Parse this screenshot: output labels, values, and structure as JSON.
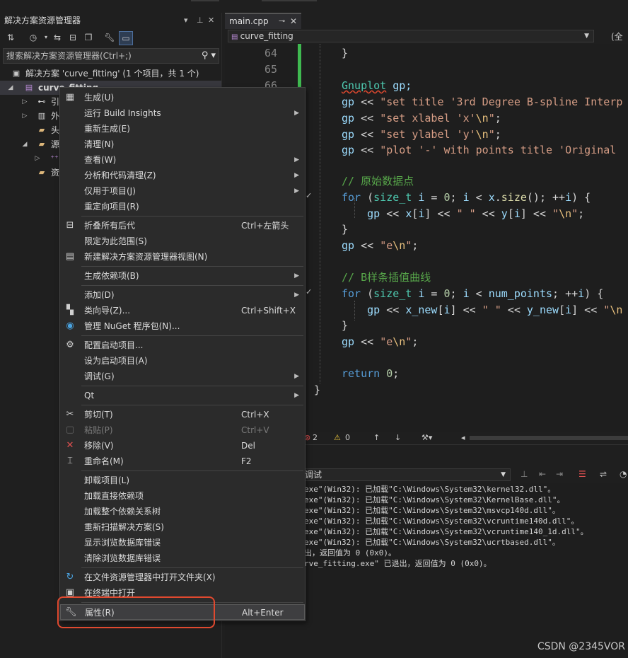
{
  "solution_explorer": {
    "title": "解决方案资源管理器",
    "controls": [
      "▾",
      "⊥",
      "✕"
    ],
    "search_placeholder": "搜索解决方案资源管理器(Ctrl+;)",
    "solution_label": "解决方案 'curve_fitting' (1 个项目，共 1 个)",
    "project_label": "curve_fitting",
    "tree_items": [
      "引",
      "外",
      "头",
      "源",
      "",
      "资"
    ]
  },
  "editor": {
    "tab_label": "main.cpp",
    "nav_scope": "curve_fitting",
    "nav_right": "(全局",
    "line_numbers": [
      "64",
      "65",
      "66"
    ],
    "lines": {
      "l64": "}",
      "l66_type": "Gnuplot",
      "l66_var": " gp;",
      "l67": "\"set title '3rd Degree B-spline Interp",
      "l68": "\"set xlabel 'x'",
      "l69": "\"set ylabel 'y'",
      "l70": "\"plot '-' with points title 'Original ",
      "c1": "// 原始数据点",
      "c2": "// B样条插值曲线",
      "ret": "return",
      "ret_val": "0"
    },
    "status": {
      "errors": "2",
      "warnings": "0"
    }
  },
  "output": {
    "source": "调试",
    "lines": [
      "exe\"(Win32): 已加载\"C:\\Windows\\System32\\kernel32.dll\"。",
      "exe\"(Win32): 已加载\"C:\\Windows\\System32\\KernelBase.dll\"。",
      "exe\"(Win32): 已加载\"C:\\Windows\\System32\\msvcp140d.dll\"。",
      "exe\"(Win32): 已加载\"C:\\Windows\\System32\\vcruntime140d.dll\"。",
      "exe\"(Win32): 已加载\"C:\\Windows\\System32\\vcruntime140_1d.dll\"。",
      "exe\"(Win32): 已加载\"C:\\Windows\\System32\\ucrtbased.dll\"。",
      "出，返回值为 0 (0x0)。",
      "rve_fitting.exe\" 已退出，返回值为 0 (0x0)。"
    ],
    "watermark": "CSDN @2345VOR"
  },
  "context_menu": {
    "items": [
      {
        "label": "生成(U)",
        "icon": "build-icon"
      },
      {
        "label": "运行 Build Insights",
        "submenu": true
      },
      {
        "label": "重新生成(E)"
      },
      {
        "label": "清理(N)"
      },
      {
        "label": "查看(W)",
        "submenu": true
      },
      {
        "label": "分析和代码清理(Z)",
        "submenu": true
      },
      {
        "label": "仅用于项目(J)",
        "submenu": true
      },
      {
        "label": "重定向项目(R)"
      },
      {
        "label": "折叠所有后代",
        "shortcut": "Ctrl+左箭头",
        "icon": "collapse-icon"
      },
      {
        "label": "限定为此范围(S)"
      },
      {
        "label": "新建解决方案资源管理器视图(N)",
        "icon": "new-view-icon"
      },
      {
        "label": "生成依赖项(B)",
        "submenu": true
      },
      {
        "label": "添加(D)",
        "submenu": true
      },
      {
        "label": "类向导(Z)...",
        "shortcut": "Ctrl+Shift+X",
        "icon": "class-wizard-icon"
      },
      {
        "label": "管理 NuGet 程序包(N)...",
        "icon": "nuget-icon"
      },
      {
        "label": "配置启动项目...",
        "icon": "gear-icon"
      },
      {
        "label": "设为启动项目(A)"
      },
      {
        "label": "调试(G)",
        "submenu": true
      },
      {
        "label": "Qt",
        "submenu": true
      },
      {
        "label": "剪切(T)",
        "shortcut": "Ctrl+X",
        "icon": "scissors-icon"
      },
      {
        "label": "粘贴(P)",
        "shortcut": "Ctrl+V",
        "icon": "paste-icon",
        "disabled": true
      },
      {
        "label": "移除(V)",
        "shortcut": "Del",
        "icon": "remove-icon"
      },
      {
        "label": "重命名(M)",
        "shortcut": "F2",
        "icon": "rename-icon"
      },
      {
        "label": "卸载项目(L)"
      },
      {
        "label": "加载直接依赖项"
      },
      {
        "label": "加载整个依赖关系树"
      },
      {
        "label": "重新扫描解决方案(S)"
      },
      {
        "label": "显示浏览数据库错误"
      },
      {
        "label": "清除浏览数据库错误"
      },
      {
        "label": "在文件资源管理器中打开文件夹(X)",
        "icon": "open-folder-icon"
      },
      {
        "label": "在终端中打开",
        "icon": "terminal-icon"
      },
      {
        "label": "属性(R)",
        "shortcut": "Alt+Enter",
        "icon": "wrench-icon"
      }
    ]
  },
  "colors": {
    "annotation_box": "#e0492f",
    "accent_green": "#3fb950"
  }
}
